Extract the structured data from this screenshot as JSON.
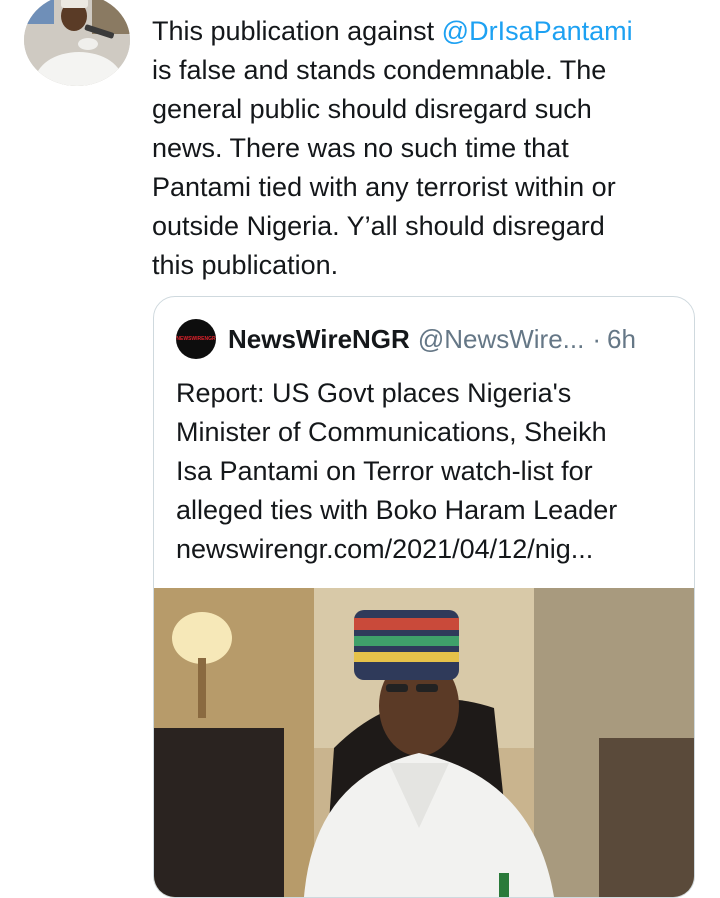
{
  "tweet": {
    "text_before_mention": "This publication against ",
    "mention": "@DrIsaPantami",
    "text_after_mention": "\nis false and stands condemnable. The\ngeneral public should disregard such\nnews. There was no such time that\nPantami tied with any terrorist within or\noutside Nigeria. Y’all should disregard\nthis publication."
  },
  "quoted_tweet": {
    "avatar_text": "NEWSWIRENGR",
    "display_name": "NewsWireNGR",
    "handle": "@NewsWire...",
    "separator": "·",
    "time": "6h",
    "text": "Report: US Govt places Nigeria's\nMinister of Communications, Sheikh\nIsa Pantami on Terror watch-list for\nalleged ties with Boko Haram Leader\nnewswirengr.com/2021/04/12/nig..."
  },
  "colors": {
    "link": "#1da1f2",
    "text": "#14171a",
    "secondary": "#657786",
    "border": "#cfd9de"
  },
  "icons": {
    "author_avatar": "profile-photo-man-in-white-cap",
    "quoted_avatar": "newswirengr-logo"
  }
}
